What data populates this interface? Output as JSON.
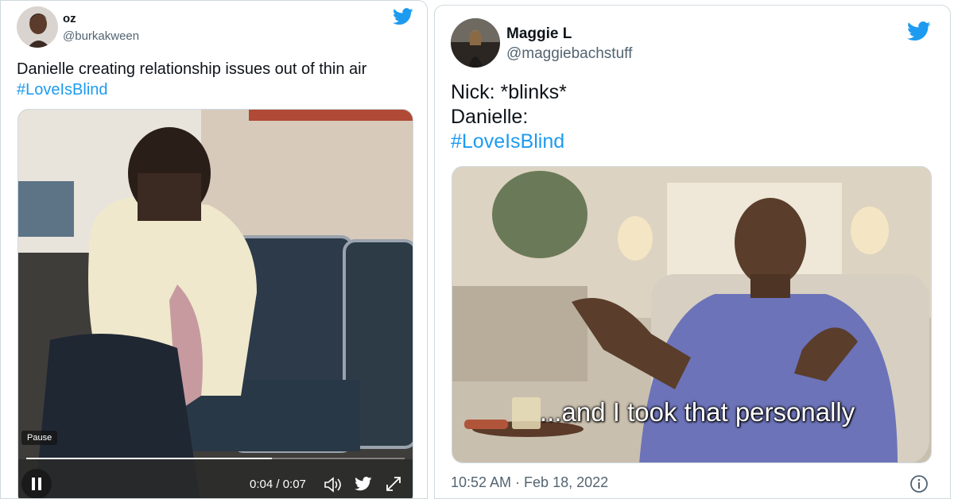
{
  "tweet1": {
    "name": "oz",
    "handle": "@burkakween",
    "text": "Danielle creating relationship issues out of thin air",
    "hashtag": "#LoveIsBlind",
    "video": {
      "pause_tooltip": "Pause",
      "time": "0:04 / 0:07",
      "progress": 0.65
    }
  },
  "tweet2": {
    "name": "Maggie L",
    "handle": "@maggiebachstuff",
    "lines": [
      "Nick: *blinks*",
      "Danielle:"
    ],
    "hashtag": "#LoveIsBlind",
    "meme_caption": "...and I took that personally",
    "timestamp": "10:52 AM · Feb 18, 2022"
  },
  "colors": {
    "accent": "#1d9bf0",
    "handle": "#536471",
    "border": "#cfd9de"
  },
  "icons": [
    "twitter-bird-icon",
    "pause-icon",
    "volume-icon",
    "fullscreen-icon",
    "info-icon"
  ]
}
